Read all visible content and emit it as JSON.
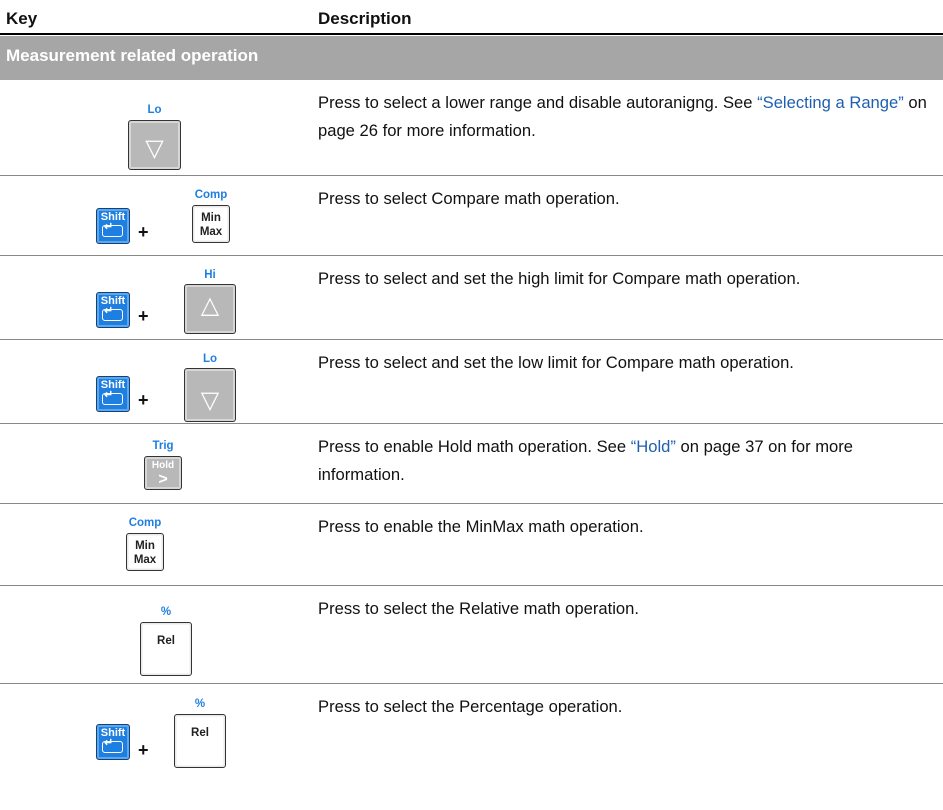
{
  "header": {
    "key": "Key",
    "description": "Description"
  },
  "section": {
    "title": "Measurement related operation"
  },
  "keys": {
    "lo": "Lo",
    "comp": "Comp",
    "hi": "Hi",
    "trig": "Trig",
    "percent": "%",
    "shift": "Shift",
    "min": "Min",
    "max": "Max",
    "hold": "Hold",
    "rel": "Rel",
    "plus": "+",
    "enter_glyph": "↵",
    "down_glyph": "▽",
    "up_glyph": "△",
    "hold_glyph": ">"
  },
  "rows": [
    {
      "pre": "Press to select a lower range and disable autoranigng. See ",
      "link": "“Selecting a Range”",
      "post": " on page 26 for more information."
    },
    {
      "pre": "Press to select Compare math operation.",
      "link": "",
      "post": ""
    },
    {
      "pre": "Press to select and set the high limit for Compare math operation.",
      "link": "",
      "post": ""
    },
    {
      "pre": "Press to select and set the low limit for Compare math operation.",
      "link": "",
      "post": ""
    },
    {
      "pre": "Press to enable Hold math operation. See ",
      "link": "“Hold”",
      "post": " on page 37 on for more information."
    },
    {
      "pre": "Press to enable the MinMax math operation.",
      "link": "",
      "post": ""
    },
    {
      "pre": "Press to select the Relative math operation.",
      "link": "",
      "post": ""
    },
    {
      "pre": "Press to select the Percentage operation.",
      "link": "",
      "post": ""
    }
  ],
  "colors": {
    "accent_blue": "#1f7fe0",
    "link": "#1f5fb0",
    "section_bg": "#a6a6a6"
  }
}
